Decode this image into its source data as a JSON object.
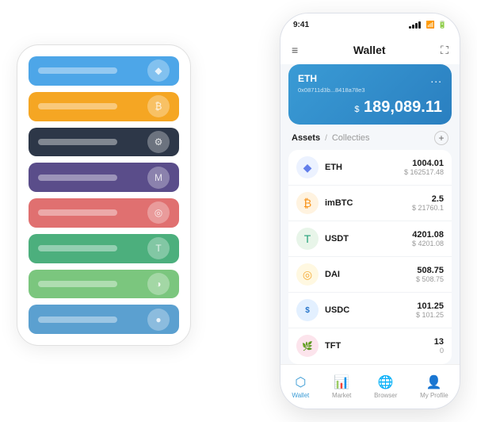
{
  "scene": {
    "left_phone": {
      "cards": [
        {
          "color": "blue",
          "label": ""
        },
        {
          "color": "orange",
          "label": ""
        },
        {
          "color": "dark",
          "label": ""
        },
        {
          "color": "purple",
          "label": ""
        },
        {
          "color": "red",
          "label": ""
        },
        {
          "color": "green1",
          "label": ""
        },
        {
          "color": "green2",
          "label": ""
        },
        {
          "color": "blue2",
          "label": ""
        }
      ]
    },
    "right_phone": {
      "status_bar": {
        "time": "9:41"
      },
      "header": {
        "title": "Wallet"
      },
      "eth_card": {
        "label": "ETH",
        "address": "0x08711d3b...8418a78e3",
        "dots": "...",
        "currency_symbol": "$",
        "balance": "189,089.11"
      },
      "assets_section": {
        "tab_active": "Assets",
        "separator": "/",
        "tab_inactive": "Collecties",
        "add_label": "+"
      },
      "assets": [
        {
          "name": "ETH",
          "amount": "1004.01",
          "usd": "$ 162517.48",
          "logo": "◆",
          "logo_class": "logo-eth"
        },
        {
          "name": "imBTC",
          "amount": "2.5",
          "usd": "$ 21760.1",
          "logo": "₿",
          "logo_class": "logo-imbtc"
        },
        {
          "name": "USDT",
          "amount": "4201.08",
          "usd": "$ 4201.08",
          "logo": "T",
          "logo_class": "logo-usdt"
        },
        {
          "name": "DAI",
          "amount": "508.75",
          "usd": "$ 508.75",
          "logo": "◎",
          "logo_class": "logo-dai"
        },
        {
          "name": "USDC",
          "amount": "101.25",
          "usd": "$ 101.25",
          "logo": "$",
          "logo_class": "logo-usdc"
        },
        {
          "name": "TFT",
          "amount": "13",
          "usd": "0",
          "logo": "🌿",
          "logo_class": "logo-tft"
        }
      ],
      "bottom_nav": [
        {
          "label": "Wallet",
          "active": true
        },
        {
          "label": "Market",
          "active": false
        },
        {
          "label": "Browser",
          "active": false
        },
        {
          "label": "My Profile",
          "active": false
        }
      ]
    }
  }
}
